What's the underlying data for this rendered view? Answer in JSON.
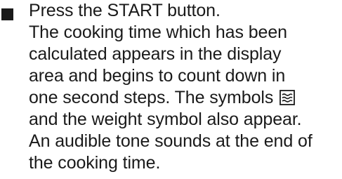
{
  "instruction": {
    "lines": [
      "Press the START button.",
      "The cooking time which has been",
      "calculated appears in the display",
      "area and begins to count down in",
      "one second steps. The symbols",
      "and the weight symbol also appear.",
      "An audible tone sounds at the end of",
      "the cooking time."
    ],
    "icon": "grill-symbol-icon"
  }
}
